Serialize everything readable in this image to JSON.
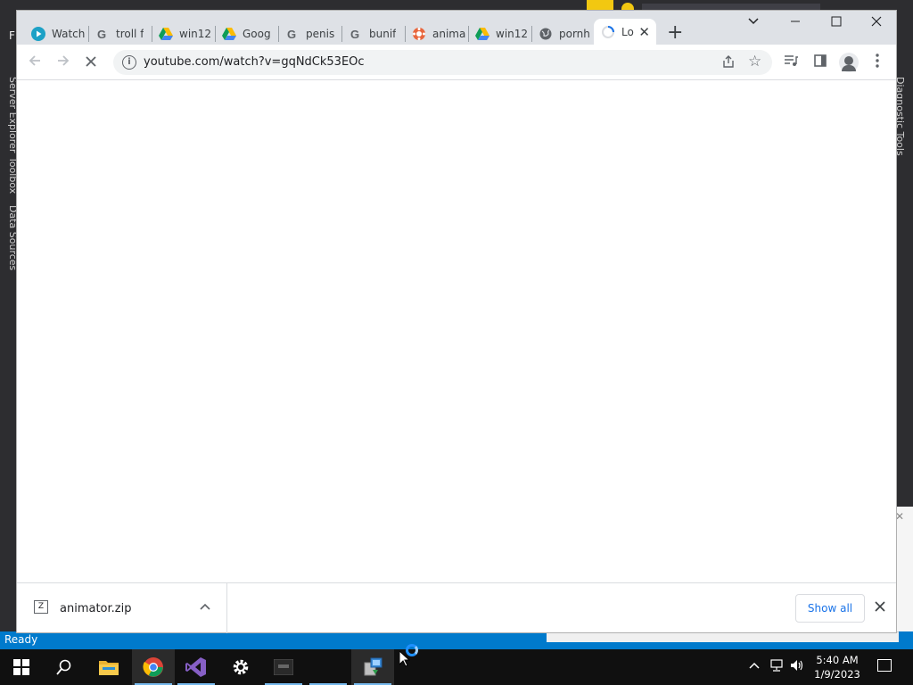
{
  "vs": {
    "menu_f": "F",
    "left_panels": [
      "Server Explorer",
      "Toolbox",
      "Data Sources"
    ],
    "right_panel": "Diagnostic Tools",
    "status": "Ready"
  },
  "chrome": {
    "tabs": [
      {
        "label": "Watch",
        "icon": "play-icon"
      },
      {
        "label": "troll f",
        "icon": "google-icon"
      },
      {
        "label": "win12",
        "icon": "drive-icon"
      },
      {
        "label": "Goog",
        "icon": "drive-icon"
      },
      {
        "label": "penis",
        "icon": "google-icon"
      },
      {
        "label": "bunif",
        "icon": "google-icon"
      },
      {
        "label": "anima",
        "icon": "gear-flower-icon"
      },
      {
        "label": "win12",
        "icon": "drive-icon"
      },
      {
        "label": "pornh",
        "icon": "globe-icon"
      },
      {
        "label": "Lo",
        "icon": "loading-icon",
        "active": true
      }
    ],
    "url": "youtube.com/watch?v=gqNdCk53EOc",
    "download": {
      "filename": "animator.zip",
      "show_all": "Show all"
    }
  },
  "taskbar": {
    "time": "5:40 AM",
    "date": "1/9/2023",
    "apps": [
      "start",
      "search",
      "file-explorer",
      "chrome",
      "visual-studio",
      "settings",
      "terminal",
      "blank",
      "app-installer"
    ]
  },
  "colors": {
    "vs_status": "#007acc",
    "accent_blue": "#1a73e8",
    "tabstrip": "#dee1e6"
  }
}
